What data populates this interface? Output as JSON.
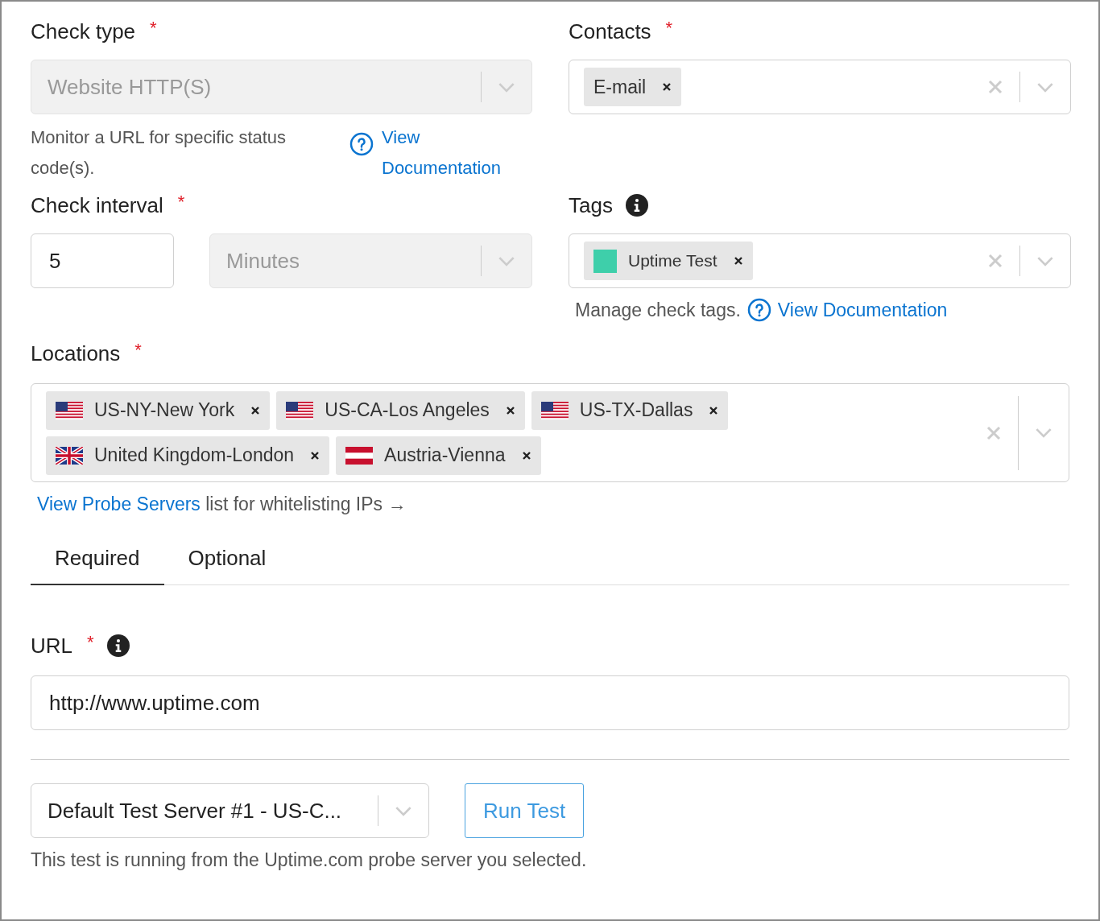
{
  "check_type": {
    "label": "Check type",
    "required_mark": "*",
    "value": "Website HTTP(S)",
    "disabled": true,
    "help": "Monitor a URL for specific status code(s).",
    "help_link": "View Documentation"
  },
  "contacts": {
    "label": "Contacts",
    "required_mark": "*",
    "chips": [
      "E-mail"
    ]
  },
  "check_interval": {
    "label": "Check interval",
    "required_mark": "*",
    "value": "5",
    "unit": "Minutes",
    "unit_disabled": true
  },
  "tags": {
    "label": "Tags",
    "chips": [
      {
        "label": "Uptime Test",
        "color": "#3ecfaa"
      }
    ],
    "help": "Manage check tags.",
    "help_link": "View Documentation"
  },
  "locations": {
    "label": "Locations",
    "required_mark": "*",
    "chips": [
      {
        "label": "US-NY-New York",
        "kind": "us"
      },
      {
        "label": "US-CA-Los Angeles",
        "kind": "us"
      },
      {
        "label": "US-TX-Dallas",
        "kind": "us"
      },
      {
        "label": "United Kingdom-London",
        "kind": "uk"
      },
      {
        "label": "Austria-Vienna",
        "kind": "at"
      }
    ],
    "note_link": "View Probe Servers",
    "note_text": "list for whitelisting IPs →"
  },
  "tabs": [
    {
      "label": "Required",
      "selected": true
    },
    {
      "label": "Optional",
      "selected": false
    }
  ],
  "url": {
    "label": "URL",
    "required_mark": "*",
    "value": "http://www.uptime.com"
  },
  "test": {
    "server": "Default Test Server #1 - US-C...",
    "button": "Run Test",
    "note": "This test is running from the Uptime.com probe server you selected."
  }
}
